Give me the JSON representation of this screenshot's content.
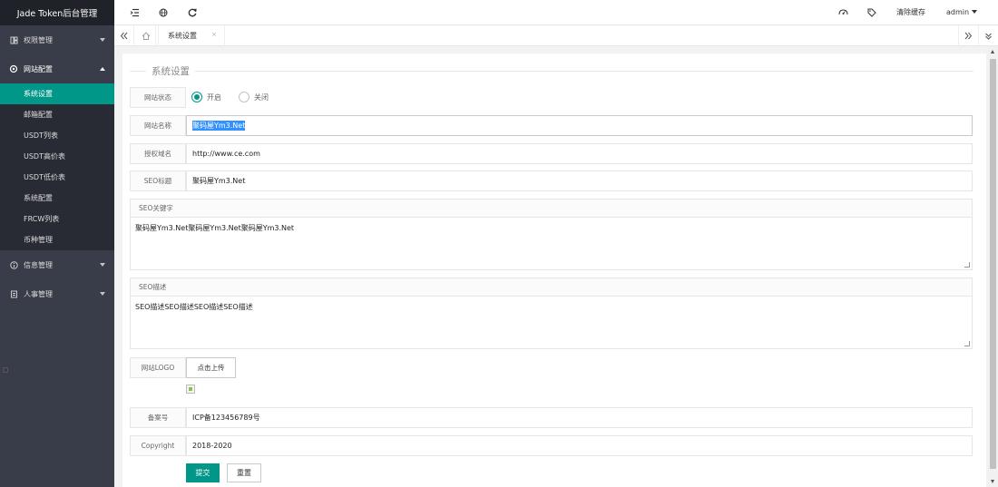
{
  "app": {
    "title": "Jade Token后台管理"
  },
  "sidebar": {
    "groups": [
      {
        "label": "权限管理",
        "icon": "layers-icon",
        "expanded": false
      },
      {
        "label": "网站配置",
        "icon": "gear-icon",
        "expanded": true,
        "items": [
          "系统设置",
          "邮箱配置",
          "USDT列表",
          "USDT高价表",
          "USDT低价表",
          "系统配置",
          "FRCW列表",
          "币种管理"
        ],
        "active_index": 0
      },
      {
        "label": "信息管理",
        "icon": "info-icon",
        "expanded": false
      },
      {
        "label": "人事管理",
        "icon": "user-icon",
        "expanded": false
      }
    ]
  },
  "header": {
    "icons": [
      "menu-fold-icon",
      "globe-icon",
      "refresh-icon",
      "theme-icon",
      "tag-icon"
    ],
    "clear_cache": "清除缓存",
    "user": "admin"
  },
  "tabs": {
    "items": [
      {
        "label": "系统设置",
        "close": "×"
      }
    ]
  },
  "form": {
    "legend": "系统设置",
    "status": {
      "label": "网站状态",
      "options": [
        "开启",
        "关闭"
      ],
      "selected": "开启"
    },
    "site_name": {
      "label": "网站名称",
      "value": "聚码屋Ym3.Net"
    },
    "auth_domain": {
      "label": "授权域名",
      "value": "http://www.ce.com"
    },
    "seo_title": {
      "label": "SEO标题",
      "value": "聚码屋Ym3.Net"
    },
    "seo_keywords": {
      "label": "SEO关键字",
      "value": "聚码屋Ym3.Net聚码屋Ym3.Net聚码屋Ym3.Net"
    },
    "seo_desc": {
      "label": "SEO描述",
      "value": "SEO描述SEO描述SEO描述SEO描述"
    },
    "logo": {
      "label": "网站LOGO",
      "upload": "点击上传"
    },
    "icp": {
      "label": "备案号",
      "value": "ICP备123456789号"
    },
    "copyright": {
      "label": "Copyright",
      "value": "2018-2020"
    },
    "submit": "提交",
    "reset": "重置"
  },
  "colors": {
    "accent": "#009688",
    "sidebar_bg": "#393d49",
    "logo_bg": "#20222a"
  }
}
